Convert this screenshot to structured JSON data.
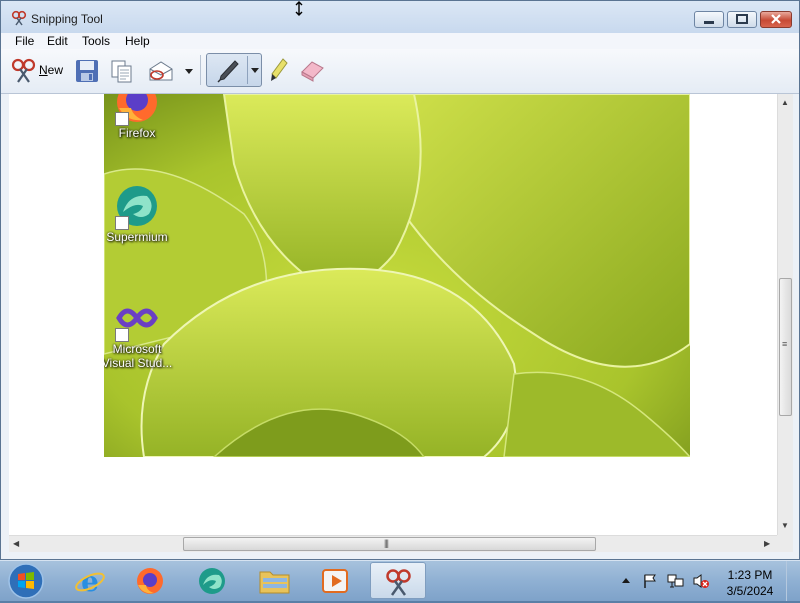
{
  "window": {
    "title": "Snipping Tool",
    "menus": [
      "File",
      "Edit",
      "Tools",
      "Help"
    ]
  },
  "toolbar": {
    "new_label": "New",
    "buttons": [
      "new-snip",
      "save",
      "copy",
      "send-snip",
      "send-dropdown",
      "pen",
      "pen-dropdown",
      "highlighter",
      "eraser"
    ]
  },
  "capture": {
    "desktop_icons": [
      {
        "label": "Firefox",
        "icon": "firefox-icon"
      },
      {
        "label": "Supermium",
        "icon": "supermium-icon"
      },
      {
        "label": "Microsoft Visual Stud...",
        "icon": "visual-studio-icon"
      }
    ]
  },
  "taskbar": {
    "apps": [
      {
        "name": "Internet Explorer",
        "icon": "internet-explorer-icon"
      },
      {
        "name": "Firefox",
        "icon": "firefox-icon"
      },
      {
        "name": "Supermium",
        "icon": "supermium-icon"
      },
      {
        "name": "Windows Explorer",
        "icon": "folder-icon"
      },
      {
        "name": "Media Player",
        "icon": "media-player-icon"
      },
      {
        "name": "Snipping Tool",
        "icon": "snipping-tool-icon",
        "active": true
      }
    ],
    "clock": {
      "time": "1:23 PM",
      "date": "3/5/2024"
    }
  },
  "colors": {
    "title_bar": "#dbe7f5",
    "close_button": "#c74a35",
    "taskbar": "#8fb0d3",
    "capture_green": "#9fb930"
  }
}
